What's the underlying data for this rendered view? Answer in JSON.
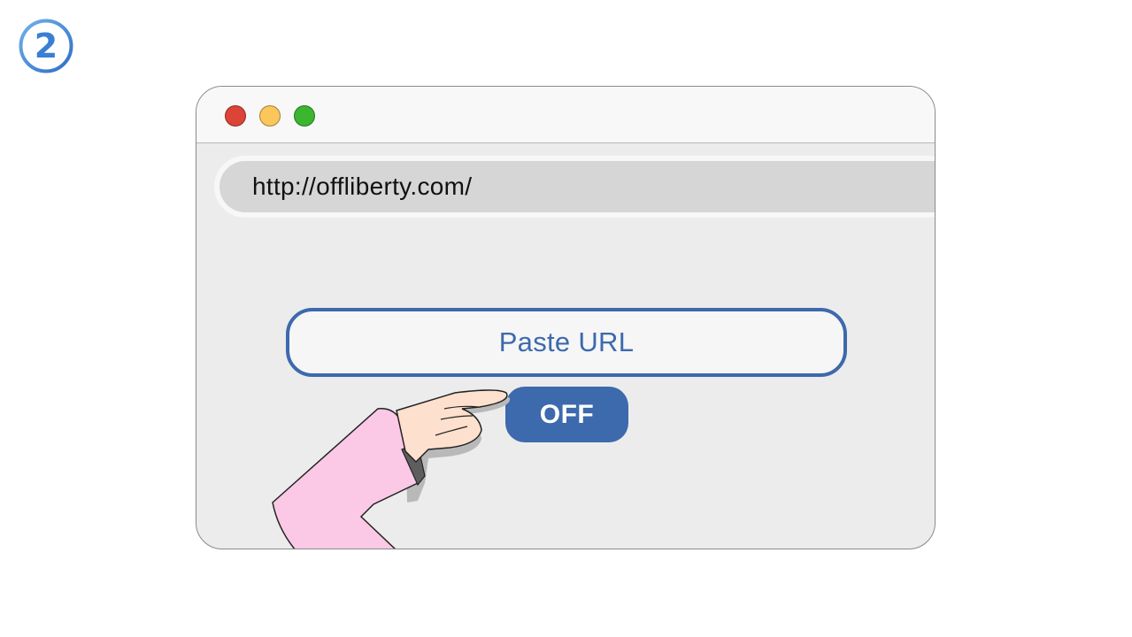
{
  "step": {
    "number": "2",
    "icon": "step-number-circle-icon",
    "color": "#3a7fd4"
  },
  "window": {
    "controls": [
      {
        "name": "close",
        "color": "#dc4437"
      },
      {
        "name": "minimize",
        "color": "#fbc65a"
      },
      {
        "name": "maximize",
        "color": "#3cb52f"
      }
    ],
    "address_bar": {
      "url": "http://offliberty.com/"
    }
  },
  "main": {
    "paste_input": {
      "placeholder": "Paste URL"
    },
    "off_button": {
      "label": "OFF",
      "color": "#3d69ad"
    }
  },
  "illustration": {
    "icon": "pointing-hand-icon",
    "sleeve_color": "#fbc8e6",
    "skin_color": "#fde0cd"
  }
}
